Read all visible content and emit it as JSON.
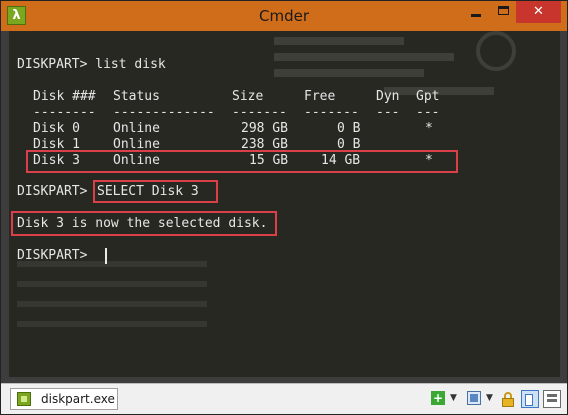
{
  "window": {
    "title": "Cmder",
    "app_icon_glyph": "λ",
    "close_glyph": "✕"
  },
  "console": {
    "prompt": "DISKPART>",
    "command1": "list disk",
    "table": {
      "headers": [
        "Disk ###",
        "Status",
        "Size",
        "Free",
        "Dyn",
        "Gpt"
      ],
      "rows": [
        {
          "disk": "Disk 0",
          "status": "Online",
          "size": "298 GB",
          "free": "0 B",
          "dyn": "",
          "gpt": "*"
        },
        {
          "disk": "Disk 1",
          "status": "Online",
          "size": "238 GB",
          "free": "0 B",
          "dyn": "",
          "gpt": ""
        },
        {
          "disk": "Disk 3",
          "status": "Online",
          "size": "15 GB",
          "free": "14 GB",
          "dyn": "",
          "gpt": "*"
        }
      ],
      "highlighted_row": "Disk 3"
    },
    "command2": "SELECT Disk 3",
    "response": "Disk 3 is now the selected disk.",
    "highlight_color": "#d9404a"
  },
  "statusbar": {
    "tab_label": "diskpart.exe",
    "new_console_icon": "plus-icon",
    "split_icon": "panes-icon",
    "lock_icon": "lock-icon"
  },
  "colors": {
    "titlebar": "#cf6d1a",
    "console_bg": "#272822",
    "console_text": "#e6e6e6"
  }
}
